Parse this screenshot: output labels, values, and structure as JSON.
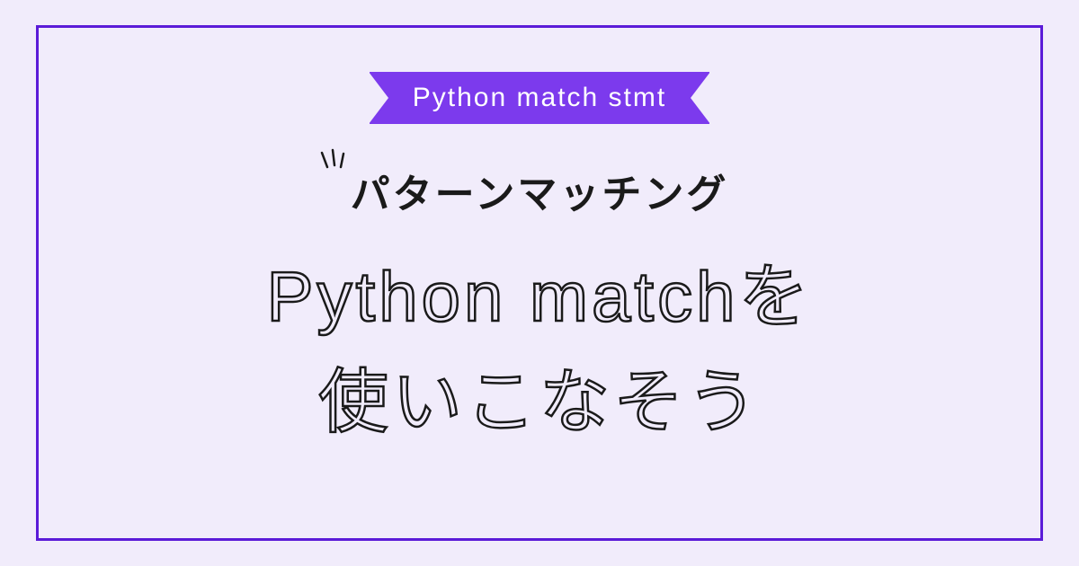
{
  "ribbon": {
    "label": "Python match stmt"
  },
  "subtitle": "パターンマッチング",
  "title": {
    "line1": "Python matchを",
    "line2": "使いこなそう"
  },
  "colors": {
    "background": "#f1ecfb",
    "border": "#5b1bd8",
    "ribbon": "#7c3aed",
    "text_dark": "#1a1a1a",
    "text_light": "#ffffff"
  }
}
